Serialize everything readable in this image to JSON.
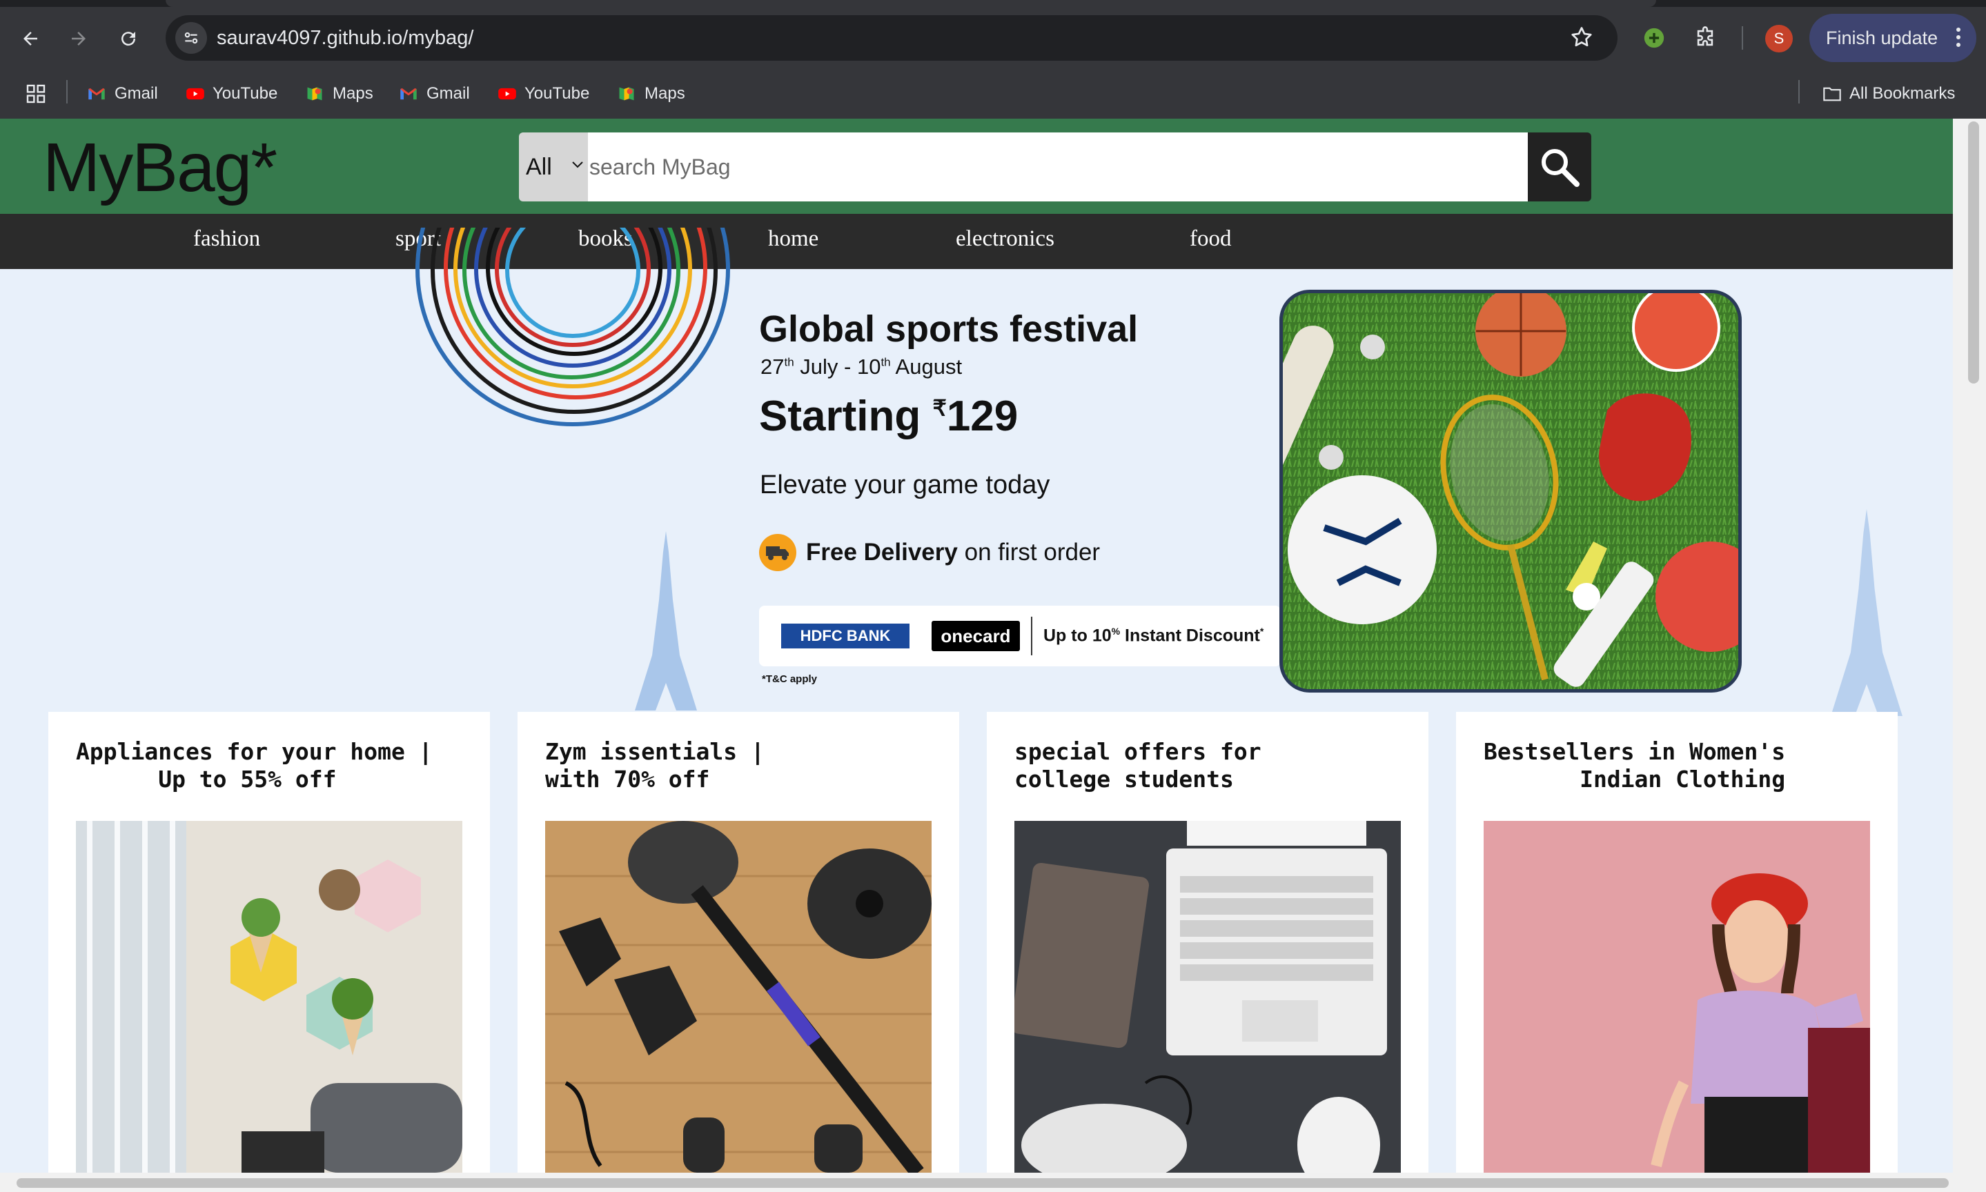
{
  "browser": {
    "url": "saurav4097.github.io/mybag/",
    "finish_update_label": "Finish update",
    "profile_initial": "S",
    "bookmarks": [
      {
        "label": "Gmail",
        "icon": "gmail-icon"
      },
      {
        "label": "YouTube",
        "icon": "youtube-icon"
      },
      {
        "label": "Maps",
        "icon": "maps-icon"
      },
      {
        "label": "Gmail",
        "icon": "gmail-icon"
      },
      {
        "label": "YouTube",
        "icon": "youtube-icon"
      },
      {
        "label": "Maps",
        "icon": "maps-icon"
      }
    ],
    "all_bookmarks_label": "All Bookmarks"
  },
  "header": {
    "logo": "MyBag*",
    "search": {
      "category": "All",
      "placeholder": "search MyBag"
    }
  },
  "nav": [
    "fashion",
    "sport",
    "books",
    "home",
    "electronics",
    "food"
  ],
  "hero": {
    "title": "Global sports festival",
    "date_start_day": "27",
    "date_start_suffix": "th",
    "date_start_month": " July - ",
    "date_end_day": "10",
    "date_end_suffix": "th",
    "date_end_month": " August",
    "price_prefix": "Starting ",
    "currency": "₹",
    "price": "129",
    "tagline": "Elevate your game today",
    "delivery_bold": "Free Delivery",
    "delivery_rest": " on first order",
    "bank_name": "HDFC BANK",
    "card_name": "onecard",
    "discount_text": "Up to 10",
    "discount_sup": "%",
    "discount_rest": " Instant Discount",
    "discount_mark": "*",
    "tnc": "*T&C apply"
  },
  "cards": [
    {
      "title": "Appliances for your home |\n      Up to 55% off"
    },
    {
      "title": "Zym issentials |\nwith 70% off"
    },
    {
      "title": "special offers for\ncollege students"
    },
    {
      "title": "Bestsellers in Women's\n       Indian Clothing"
    }
  ],
  "colors": {
    "header_green": "#367a4d",
    "nav_dark": "#2b2b2b",
    "page_bg": "#e8f0fa",
    "chrome_bg": "#35363a"
  }
}
